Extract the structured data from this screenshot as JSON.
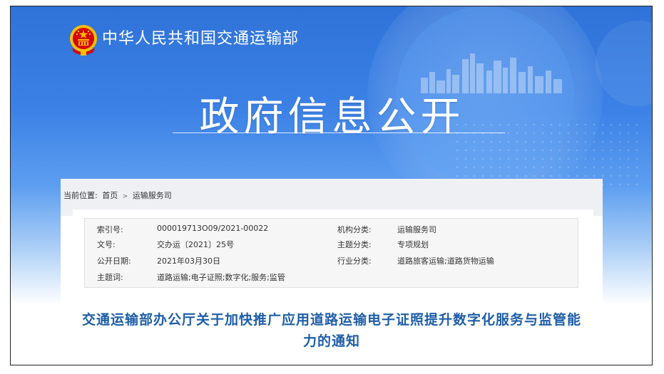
{
  "header": {
    "ministry_name": "中华人民共和国交通运输部",
    "main_title": "政府信息公开"
  },
  "breadcrumb": {
    "label": "当前位置:",
    "items": [
      "首页",
      "运输服务司"
    ],
    "separator": ">"
  },
  "meta": {
    "index_label": "索引号:",
    "index_value": "000019713O09/2021-00022",
    "docno_label": "文号:",
    "docno_value": "交办运〔2021〕25号",
    "date_label": "公开日期:",
    "date_value": "2021年03月30日",
    "subject_label": "主题词:",
    "subject_value": "道路运输;电子证照;数字化;服务;监管",
    "org_label": "机构分类:",
    "org_value": "运输服务司",
    "topic_label": "主题分类:",
    "topic_value": "专项规划",
    "industry_label": "行业分类:",
    "industry_value": "道路旅客运输;道路货物运输"
  },
  "document": {
    "title": "交通运输部办公厅关于加快推广应用道路运输电子证照提升数字化服务与监管能力的通知"
  },
  "colors": {
    "hero_blue": "#3c82e6",
    "title_blue": "#1e5ea8",
    "emblem_red": "#d7000f",
    "emblem_gold": "#f5c000"
  }
}
